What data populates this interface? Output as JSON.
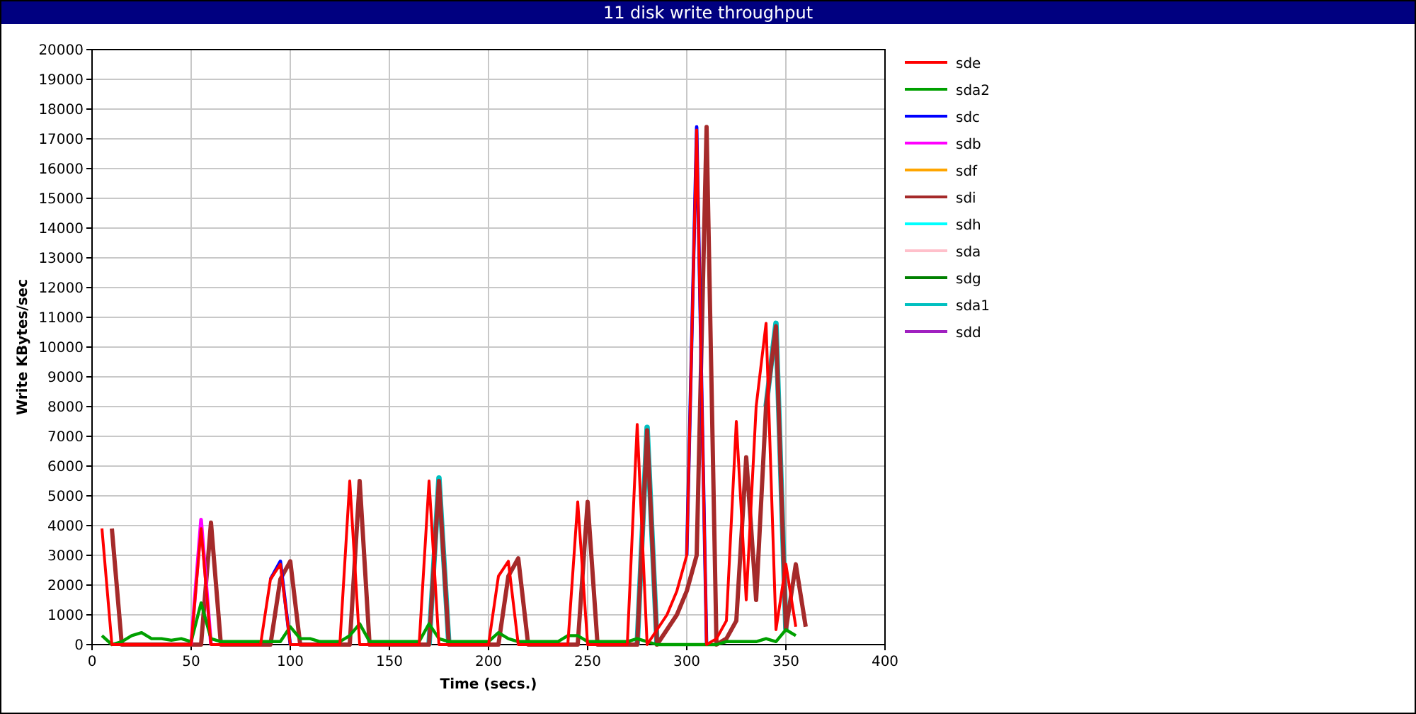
{
  "window": {
    "title": "11 disk write throughput"
  },
  "chart": {
    "chart_data": {
      "type": "line",
      "xlabel": "Time (secs.)",
      "ylabel": "Write KBytes/sec",
      "grid": true,
      "legend": true,
      "xlim": [
        0,
        400
      ],
      "ylim": [
        0,
        20000
      ],
      "xticks": [
        0,
        50,
        100,
        150,
        200,
        250,
        300,
        350,
        400
      ],
      "yticks": [
        0,
        1000,
        2000,
        3000,
        4000,
        5000,
        6000,
        7000,
        8000,
        9000,
        10000,
        11000,
        12000,
        13000,
        14000,
        15000,
        16000,
        17000,
        18000,
        19000,
        20000
      ],
      "x": [
        5,
        10,
        15,
        20,
        25,
        30,
        35,
        40,
        45,
        50,
        55,
        60,
        65,
        70,
        75,
        80,
        85,
        90,
        95,
        100,
        105,
        110,
        115,
        120,
        125,
        130,
        135,
        140,
        145,
        150,
        155,
        160,
        165,
        170,
        175,
        180,
        185,
        190,
        195,
        200,
        205,
        210,
        215,
        220,
        225,
        230,
        235,
        240,
        245,
        250,
        255,
        260,
        265,
        270,
        275,
        280,
        285,
        290,
        295,
        300,
        305,
        310,
        315,
        320,
        325,
        330,
        335,
        340,
        345,
        350,
        355,
        360
      ],
      "series": [
        {
          "name": "sde",
          "color": "#ff0000",
          "values": [
            3900,
            0,
            0,
            0,
            0,
            0,
            0,
            0,
            0,
            0,
            3900,
            0,
            0,
            0,
            0,
            0,
            0,
            2200,
            2700,
            0,
            0,
            0,
            0,
            0,
            0,
            5500,
            0,
            0,
            0,
            0,
            0,
            0,
            0,
            5500,
            0,
            0,
            0,
            0,
            0,
            0,
            2300,
            2800,
            0,
            0,
            0,
            0,
            0,
            0,
            4800,
            0,
            0,
            0,
            0,
            0,
            7400,
            0,
            500,
            1000,
            1800,
            3000,
            17300,
            0,
            200,
            800,
            7500,
            1500,
            8000,
            10800,
            500,
            2700,
            600,
            null
          ]
        },
        {
          "name": "sda2",
          "color": "#00a000",
          "values": [
            300,
            0,
            100,
            300,
            400,
            200,
            200,
            150,
            200,
            100,
            1400,
            200,
            100,
            100,
            100,
            100,
            100,
            100,
            100,
            600,
            200,
            200,
            100,
            100,
            100,
            300,
            700,
            100,
            100,
            100,
            100,
            100,
            100,
            700,
            200,
            100,
            100,
            100,
            100,
            100,
            400,
            200,
            100,
            100,
            100,
            100,
            100,
            300,
            300,
            100,
            100,
            100,
            100,
            100,
            200,
            100,
            0,
            0,
            0,
            0,
            0,
            0,
            0,
            100,
            100,
            100,
            100,
            200,
            100,
            500,
            300,
            null
          ]
        },
        {
          "name": "sdc",
          "color": "#0000ff",
          "values": [
            null,
            null,
            null,
            null,
            null,
            null,
            null,
            null,
            null,
            null,
            null,
            null,
            null,
            null,
            null,
            null,
            null,
            2200,
            2800,
            0,
            null,
            null,
            null,
            null,
            null,
            null,
            null,
            null,
            null,
            null,
            null,
            null,
            null,
            null,
            null,
            null,
            null,
            null,
            null,
            null,
            null,
            null,
            null,
            null,
            null,
            null,
            null,
            null,
            null,
            null,
            null,
            null,
            null,
            null,
            null,
            null,
            null,
            null,
            null,
            3000,
            17400,
            0,
            null,
            null,
            null,
            null,
            null,
            null,
            null,
            null,
            null,
            null
          ]
        },
        {
          "name": "sdb",
          "color": "#ff00ff",
          "values": [
            null,
            null,
            null,
            null,
            null,
            null,
            null,
            null,
            null,
            0,
            4200,
            0,
            null,
            null,
            null,
            null,
            null,
            null,
            null,
            null,
            null,
            null,
            null,
            null,
            null,
            null,
            null,
            null,
            null,
            null,
            null,
            null,
            null,
            null,
            null,
            null,
            null,
            null,
            null,
            null,
            null,
            null,
            null,
            null,
            null,
            null,
            null,
            null,
            null,
            null,
            null,
            null,
            null,
            null,
            null,
            null,
            null,
            null,
            null,
            null,
            null,
            null,
            null,
            null,
            null,
            null,
            null,
            null,
            null,
            null,
            null,
            null
          ]
        },
        {
          "name": "sdf",
          "color": "#ffa500",
          "values": [
            null,
            null,
            null,
            null,
            null,
            null,
            null,
            null,
            null,
            null,
            null,
            null,
            null,
            null,
            null,
            null,
            null,
            null,
            null,
            null,
            null,
            null,
            null,
            null,
            null,
            null,
            null,
            null,
            null,
            null,
            null,
            null,
            null,
            null,
            null,
            null,
            null,
            null,
            null,
            null,
            null,
            null,
            null,
            null,
            null,
            null,
            null,
            null,
            null,
            null,
            null,
            null,
            null,
            null,
            null,
            null,
            null,
            null,
            null,
            null,
            null,
            null,
            null,
            null,
            null,
            null,
            null,
            null,
            null,
            null,
            null,
            null
          ]
        },
        {
          "name": "sdi",
          "color": "#a52a2a",
          "values": [
            null,
            3900,
            0,
            0,
            0,
            0,
            0,
            0,
            0,
            0,
            0,
            4100,
            0,
            0,
            0,
            0,
            0,
            0,
            2200,
            2800,
            0,
            0,
            0,
            0,
            0,
            0,
            5500,
            0,
            0,
            0,
            0,
            0,
            0,
            0,
            5500,
            0,
            0,
            0,
            0,
            0,
            0,
            2300,
            2900,
            0,
            0,
            0,
            0,
            0,
            0,
            4800,
            0,
            0,
            0,
            0,
            0,
            7200,
            0,
            500,
            1000,
            1800,
            3000,
            17400,
            0,
            200,
            800,
            6300,
            1500,
            8000,
            10700,
            500,
            2700,
            600
          ]
        },
        {
          "name": "sdh",
          "color": "#00ffff",
          "values": [
            null,
            null,
            null,
            null,
            null,
            null,
            null,
            null,
            null,
            null,
            null,
            null,
            null,
            null,
            null,
            null,
            null,
            null,
            null,
            null,
            null,
            null,
            null,
            null,
            null,
            null,
            null,
            null,
            null,
            null,
            null,
            null,
            null,
            null,
            null,
            null,
            null,
            null,
            null,
            null,
            null,
            null,
            null,
            null,
            null,
            null,
            null,
            null,
            null,
            null,
            null,
            null,
            null,
            null,
            null,
            null,
            null,
            null,
            null,
            null,
            null,
            null,
            null,
            null,
            null,
            null,
            null,
            null,
            null,
            null,
            null,
            null
          ]
        },
        {
          "name": "sda",
          "color": "#ffc0cb",
          "values": [
            null,
            null,
            null,
            null,
            null,
            null,
            null,
            null,
            null,
            null,
            null,
            null,
            null,
            null,
            null,
            null,
            null,
            null,
            null,
            null,
            null,
            null,
            null,
            null,
            null,
            null,
            null,
            null,
            null,
            null,
            null,
            null,
            null,
            null,
            null,
            null,
            null,
            null,
            null,
            null,
            null,
            null,
            null,
            null,
            null,
            null,
            null,
            null,
            null,
            null,
            null,
            null,
            null,
            null,
            null,
            null,
            null,
            null,
            null,
            null,
            null,
            null,
            null,
            null,
            null,
            null,
            null,
            null,
            null,
            null,
            null,
            null
          ]
        },
        {
          "name": "sdg",
          "color": "#008000",
          "values": [
            null,
            null,
            null,
            null,
            null,
            null,
            null,
            null,
            null,
            null,
            null,
            null,
            null,
            null,
            null,
            null,
            null,
            null,
            null,
            null,
            null,
            null,
            null,
            null,
            null,
            null,
            null,
            null,
            null,
            null,
            null,
            null,
            null,
            null,
            null,
            null,
            null,
            null,
            null,
            null,
            null,
            null,
            null,
            null,
            null,
            null,
            null,
            null,
            null,
            null,
            null,
            null,
            null,
            null,
            null,
            null,
            null,
            null,
            null,
            null,
            null,
            null,
            null,
            null,
            null,
            null,
            null,
            null,
            null,
            null,
            null,
            null
          ]
        },
        {
          "name": "sda1",
          "color": "#00c0c0",
          "values": [
            null,
            null,
            null,
            null,
            null,
            null,
            null,
            null,
            null,
            null,
            null,
            null,
            null,
            null,
            null,
            null,
            null,
            null,
            null,
            null,
            null,
            null,
            null,
            null,
            null,
            null,
            null,
            null,
            null,
            null,
            null,
            null,
            null,
            0,
            5600,
            0,
            null,
            null,
            null,
            null,
            null,
            null,
            null,
            null,
            null,
            null,
            null,
            null,
            null,
            null,
            null,
            null,
            null,
            null,
            0,
            7300,
            0,
            null,
            null,
            null,
            null,
            null,
            null,
            null,
            null,
            null,
            null,
            8000,
            10800,
            500,
            null,
            null
          ]
        },
        {
          "name": "sdd",
          "color": "#a020c0",
          "values": [
            null,
            null,
            null,
            null,
            null,
            null,
            null,
            null,
            null,
            null,
            null,
            null,
            null,
            null,
            null,
            null,
            null,
            null,
            null,
            null,
            null,
            null,
            null,
            null,
            null,
            null,
            null,
            null,
            null,
            null,
            null,
            null,
            null,
            null,
            null,
            null,
            null,
            null,
            null,
            null,
            null,
            null,
            null,
            null,
            null,
            null,
            null,
            null,
            null,
            null,
            null,
            null,
            null,
            null,
            null,
            null,
            null,
            null,
            null,
            null,
            null,
            null,
            null,
            null,
            null,
            null,
            null,
            null,
            null,
            null,
            null,
            null
          ]
        }
      ]
    }
  }
}
